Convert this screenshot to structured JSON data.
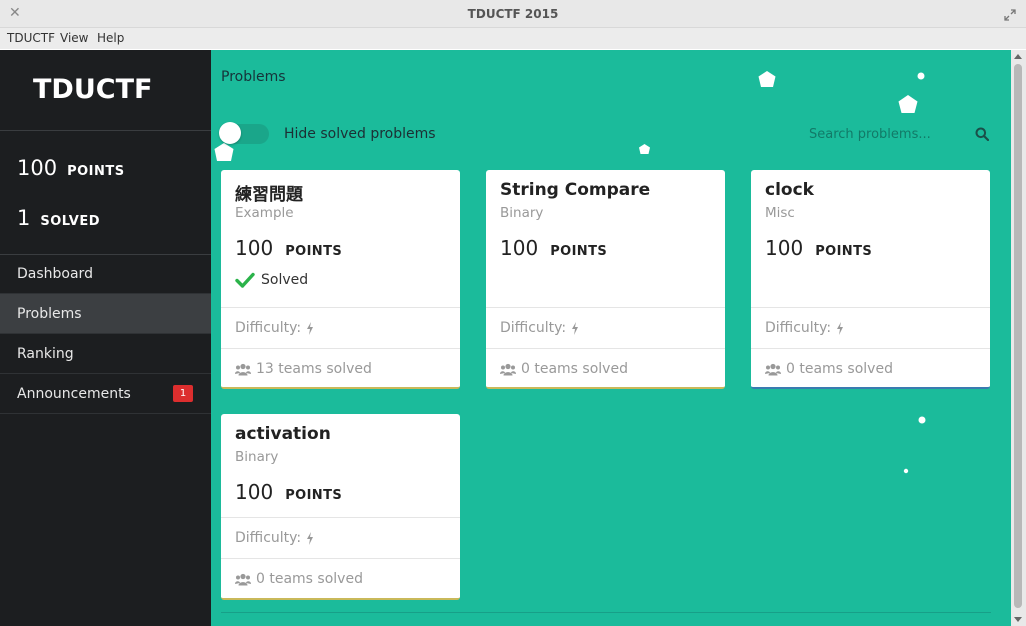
{
  "window": {
    "title": "TDUCTF 2015"
  },
  "menu": [
    "TDUCTF",
    "View",
    "Help"
  ],
  "sidebar": {
    "brand": "TDUCTF",
    "points": {
      "value": "100",
      "unit": "POINTS"
    },
    "solved": {
      "value": "1",
      "unit": "SOLVED"
    },
    "nav": [
      {
        "label": "Dashboard",
        "active": false
      },
      {
        "label": "Problems",
        "active": true
      },
      {
        "label": "Ranking",
        "active": false
      },
      {
        "label": "Announcements",
        "active": false,
        "badge": "1"
      }
    ]
  },
  "main": {
    "title": "Problems",
    "toggle_label": "Hide solved problems",
    "search_placeholder": "Search problems..."
  },
  "labels": {
    "points_unit": "POINTS",
    "difficulty": "Difficulty:"
  },
  "problems": [
    {
      "name": "練習問題",
      "category": "Example",
      "points": "100",
      "status": "Solved",
      "teams": "13 teams solved"
    },
    {
      "name": "String Compare",
      "category": "Binary",
      "points": "100",
      "teams": "0 teams solved"
    },
    {
      "name": "clock",
      "category": "Misc",
      "points": "100",
      "teams": "0 teams solved"
    },
    {
      "name": "activation",
      "category": "Binary",
      "points": "100",
      "teams": "0 teams solved"
    }
  ],
  "colors": {
    "accent": "#1bbb9b",
    "sidebar": "#1c1e20",
    "badge": "#dc2e2e",
    "check": "#2bb34a"
  }
}
